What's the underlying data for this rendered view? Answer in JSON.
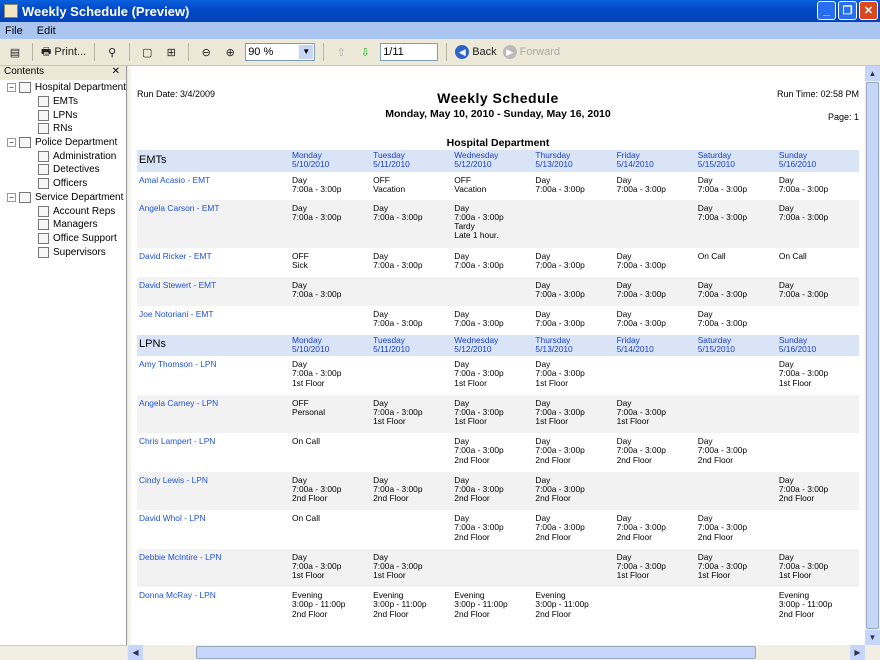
{
  "window": {
    "title": "Weekly Schedule (Preview)"
  },
  "menu": [
    "File",
    "Edit"
  ],
  "toolbar": {
    "print": "Print...",
    "zoom": "90 %",
    "page": "1/11",
    "back": "Back",
    "forward": "Forward"
  },
  "contents": {
    "title": "Contents",
    "tree": [
      {
        "label": "Hospital Department",
        "children": [
          "EMTs",
          "LPNs",
          "RNs"
        ]
      },
      {
        "label": "Police Department",
        "children": [
          "Administration",
          "Detectives",
          "Officers"
        ]
      },
      {
        "label": "Service Department",
        "children": [
          "Account Reps",
          "Managers",
          "Office Support",
          "Supervisors"
        ]
      }
    ]
  },
  "report": {
    "run_date": "Run Date: 3/4/2009",
    "run_time": "Run Time: 02:58 PM",
    "title": "Weekly Schedule",
    "subtitle": "Monday, May 10, 2010 - Sunday, May 16, 2010",
    "page": "Page: 1",
    "department": "Hospital Department",
    "days": [
      [
        "Monday",
        "5/10/2010"
      ],
      [
        "Tuesday",
        "5/11/2010"
      ],
      [
        "Wednesday",
        "5/12/2010"
      ],
      [
        "Thursday",
        "5/13/2010"
      ],
      [
        "Friday",
        "5/14/2010"
      ],
      [
        "Saturday",
        "5/15/2010"
      ],
      [
        "Sunday",
        "5/16/2010"
      ]
    ],
    "groups": [
      {
        "name": "EMTs",
        "rows": [
          {
            "name": "Amal Acasio - EMT",
            "days": [
              "Day\n7:00a - 3:00p",
              "OFF\nVacation",
              "OFF\nVacation",
              "Day\n7:00a - 3:00p",
              "Day\n7:00a - 3:00p",
              "Day\n7:00a - 3:00p",
              "Day\n7:00a - 3:00p"
            ]
          },
          {
            "name": "Angela Carson - EMT",
            "days": [
              "Day\n7:00a - 3:00p",
              "Day\n7:00a - 3:00p",
              "Day\n7:00a - 3:00p\nTardy\nLate 1 hour.",
              "",
              "",
              "Day\n7:00a - 3:00p",
              "Day\n7:00a - 3:00p"
            ]
          },
          {
            "name": "David Ricker - EMT",
            "days": [
              "OFF\nSick",
              "Day\n7:00a - 3:00p",
              "Day\n7:00a - 3:00p",
              "Day\n7:00a - 3:00p",
              "Day\n7:00a - 3:00p",
              "On Call",
              "On Call"
            ]
          },
          {
            "name": "David Stewert - EMT",
            "days": [
              "Day\n7:00a - 3:00p",
              "",
              "",
              "Day\n7:00a - 3:00p",
              "Day\n7:00a - 3:00p",
              "Day\n7:00a - 3:00p",
              "Day\n7:00a - 3:00p"
            ]
          },
          {
            "name": "Joe Notoriani - EMT",
            "days": [
              "",
              "Day\n7:00a - 3:00p",
              "Day\n7:00a - 3:00p",
              "Day\n7:00a - 3:00p",
              "Day\n7:00a - 3:00p",
              "Day\n7:00a - 3:00p",
              ""
            ]
          }
        ]
      },
      {
        "name": "LPNs",
        "rows": [
          {
            "name": "Amy Thomson - LPN",
            "days": [
              "Day\n7:00a - 3:00p\n1st Floor",
              "",
              "Day\n7:00a - 3:00p\n1st Floor",
              "Day\n7:00a - 3:00p\n1st Floor",
              "",
              "",
              "Day\n7:00a - 3:00p\n1st Floor"
            ]
          },
          {
            "name": "Angela Carney - LPN",
            "days": [
              "OFF\nPersonal",
              "Day\n7:00a - 3:00p\n1st Floor",
              "Day\n7:00a - 3:00p\n1st Floor",
              "Day\n7:00a - 3:00p\n1st Floor",
              "Day\n7:00a - 3:00p\n1st Floor",
              "",
              ""
            ]
          },
          {
            "name": "Chris Lampert - LPN",
            "days": [
              "On Call",
              "",
              "Day\n7:00a - 3:00p\n2nd Floor",
              "Day\n7:00a - 3:00p\n2nd Floor",
              "Day\n7:00a - 3:00p\n2nd Floor",
              "Day\n7:00a - 3:00p\n2nd Floor",
              ""
            ]
          },
          {
            "name": "Cindy Lewis - LPN",
            "days": [
              "Day\n7:00a - 3:00p\n2nd Floor",
              "Day\n7:00a - 3:00p\n2nd Floor",
              "Day\n7:00a - 3:00p\n2nd Floor",
              "Day\n7:00a - 3:00p\n2nd Floor",
              "",
              "",
              "Day\n7:00a - 3:00p\n2nd Floor"
            ]
          },
          {
            "name": "David Whol - LPN",
            "days": [
              "On Call",
              "",
              "Day\n7:00a - 3:00p\n2nd Floor",
              "Day\n7:00a - 3:00p\n2nd Floor",
              "Day\n7:00a - 3:00p\n2nd Floor",
              "Day\n7:00a - 3:00p\n2nd Floor",
              ""
            ]
          },
          {
            "name": "Debbie McIntire - LPN",
            "days": [
              "Day\n7:00a - 3:00p\n1st Floor",
              "Day\n7:00a - 3:00p\n1st Floor",
              "",
              "",
              "Day\n7:00a - 3:00p\n1st Floor",
              "Day\n7:00a - 3:00p\n1st Floor",
              "Day\n7:00a - 3:00p\n1st Floor"
            ]
          },
          {
            "name": "Donna McRay - LPN",
            "days": [
              "Evening\n3:00p - 11:00p\n2nd Floor",
              "Evening\n3:00p - 11:00p\n2nd Floor",
              "Evening\n3:00p - 11:00p\n2nd Floor",
              "Evening\n3:00p - 11:00p\n2nd Floor",
              "",
              "",
              "Evening\n3:00p - 11:00p\n2nd Floor"
            ]
          }
        ]
      }
    ]
  }
}
